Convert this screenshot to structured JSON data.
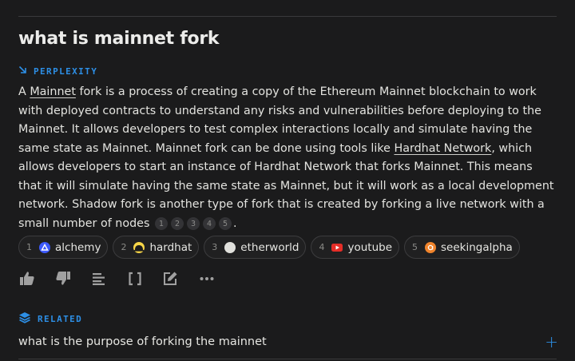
{
  "query": {
    "title": "what is mainnet fork"
  },
  "source_section": {
    "label": "PERPLEXITY"
  },
  "answer": {
    "seg1": "A ",
    "link1": "Mainnet",
    "seg2": " fork is a process of creating a copy of the Ethereum Mainnet blockchain to work with deployed contracts to understand any risks and vulnerabilities before deploying to the Mainnet. It allows developers to test complex interactions locally and simulate having the same state as Mainnet. Mainnet fork can be done using tools like ",
    "link2": "Hardhat Network",
    "seg3": ", which allows developers to start an instance of Hardhat Network that forks Mainnet. This means that it will simulate having the same state as Mainnet, but it will work as a local development network. Shadow fork is another type of fork that is created by forking a live network with a small number of nodes",
    "citations": [
      "1",
      "2",
      "3",
      "4",
      "5"
    ],
    "end": "."
  },
  "sources": [
    {
      "num": "1",
      "name": "alchemy",
      "icon": "alchemy-favicon",
      "color": "#3d5afe"
    },
    {
      "num": "2",
      "name": "hardhat",
      "icon": "hardhat-favicon",
      "color": "#f7d548"
    },
    {
      "num": "3",
      "name": "etherworld",
      "icon": "etherworld-favicon",
      "color": "#e0e0dc"
    },
    {
      "num": "4",
      "name": "youtube",
      "icon": "youtube-favicon",
      "color": "#e52d27"
    },
    {
      "num": "5",
      "name": "seekingalpha",
      "icon": "seekingalpha-favicon",
      "color": "#f0842c"
    }
  ],
  "actions": [
    "thumbs-up-icon",
    "thumbs-down-icon",
    "text-lines-icon",
    "brackets-icon",
    "edit-icon",
    "more-icon"
  ],
  "related_section": {
    "label": "RELATED",
    "items": [
      {
        "text": "what is the purpose of forking the mainnet"
      }
    ]
  },
  "colors": {
    "accent": "#2d8fe6",
    "background": "#1b1b1c",
    "text": "#e3e3df"
  }
}
